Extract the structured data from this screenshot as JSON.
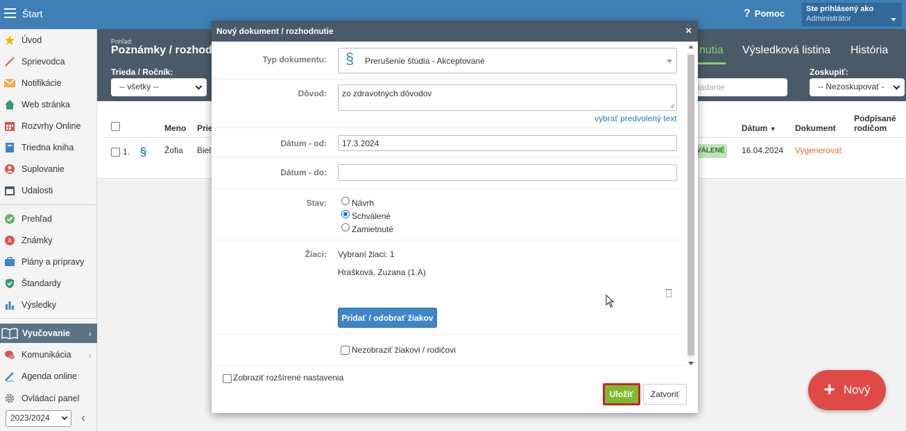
{
  "topbar": {
    "start_label": "Štart",
    "help_label": "Pomoc",
    "user_line1": "Ste prihlásený ako",
    "user_line2": "Administrátor"
  },
  "sidebar": {
    "items": [
      {
        "label": "Úvod",
        "icon": "star-icon"
      },
      {
        "label": "Sprievodca",
        "icon": "wand-icon"
      },
      {
        "label": "Notifikácie",
        "icon": "envelope-icon"
      },
      {
        "label": "Web stránka",
        "icon": "home-icon"
      },
      {
        "label": "Rozvrhy Online",
        "icon": "calendar-grid-icon"
      },
      {
        "label": "Triedna kniha",
        "icon": "book-icon"
      },
      {
        "label": "Suplovanie",
        "icon": "person-icon"
      },
      {
        "label": "Udalosti",
        "icon": "calendar-icon"
      },
      {
        "label": "Prehľad",
        "icon": "check-circle-icon"
      },
      {
        "label": "Známky",
        "icon": "grade-icon"
      },
      {
        "label": "Plány a prípravy",
        "icon": "briefcase-icon"
      },
      {
        "label": "Štandardy",
        "icon": "shield-icon"
      },
      {
        "label": "Výsledky",
        "icon": "bar-chart-icon"
      },
      {
        "label": "Vyučovanie",
        "icon": "open-book-icon"
      },
      {
        "label": "Komunikácia",
        "icon": "chat-icon"
      },
      {
        "label": "Agenda online",
        "icon": "pen-icon"
      },
      {
        "label": "Ovládací panel",
        "icon": "gear-icon"
      }
    ],
    "year": "2023/2024"
  },
  "main": {
    "pohlad_label": "Pohľad:",
    "title": "Poznámky / rozhod",
    "tabs": {
      "active": "nutia",
      "t2": "Výsledková listina",
      "t3": "História"
    },
    "filter_class_label": "Trieda / Ročník:",
    "filter_class_value": "-- všetky --",
    "search_placeholder": "ladanie",
    "group_label": "Zoskupiť:",
    "group_value": "-- Nezoskupovať -",
    "columns": {
      "meno": "Meno",
      "prie": "Prie",
      "datum": "Dátum",
      "dokument": "Dokument",
      "podpisane1": "Podpísané",
      "podpisane2": "rodičom"
    },
    "row": {
      "num": "1.",
      "meno": "Žofia",
      "prie": "Biel",
      "badge": "VÁLENÉ",
      "datum": "16.04.2024",
      "dokument": "Vygenerovať"
    }
  },
  "fab": {
    "label": "Nový"
  },
  "modal": {
    "title": "Nový dokument / rozhodnutie",
    "close": "×",
    "typ_label": "Typ dokumentu:",
    "typ_value": "Prerušenie štúdia - Akceptované",
    "typ_icon": "§",
    "dovod_label": "Dôvod:",
    "dovod_value": "zo zdravotných dôvodov",
    "default_text_link": "vybrať predvolený text",
    "od_label": "Dátum - od:",
    "od_value": "17.3.2024",
    "do_label": "Dátum - do:",
    "do_value": "",
    "stav_label": "Stav:",
    "stav_options": [
      "Návrh",
      "Schválené",
      "Zamietnuté"
    ],
    "stav_selected": "Schválené",
    "ziaci_label": "Žiaci:",
    "selected_count": "Vybraní žiaci: 1",
    "student": "Hrašková, Zuzana (1.A)",
    "add_remove_btn": "Pridať / odobrať žiakov",
    "hide_label": "Nezobraziť žiakovi / rodičovi",
    "advanced_label": "Zobraziť rozšírené nastavenia",
    "save": "Uložiť",
    "close_btn": "Zatvoriť"
  },
  "colors": {
    "header": "#4a5a68",
    "topbar": "#3f7fb5",
    "accent_green": "#8bd06a",
    "save_btn": "#7dbb2e",
    "highlight": "#d0202a",
    "fab": "#e04a46"
  }
}
